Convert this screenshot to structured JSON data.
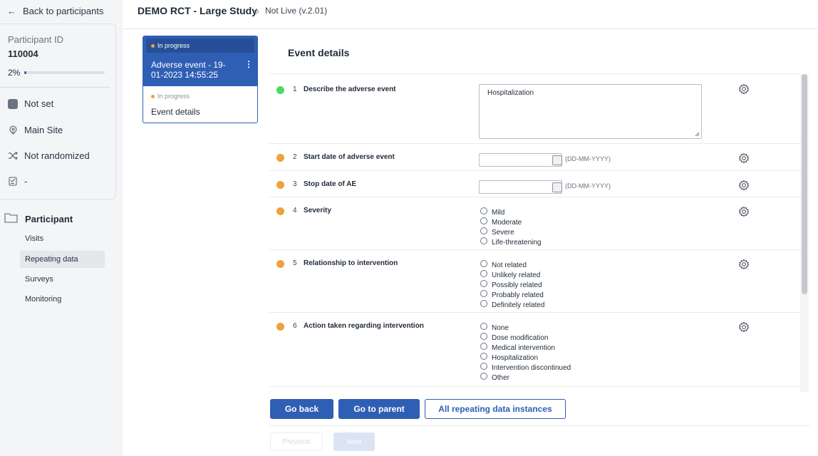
{
  "sidebar": {
    "back_label": "Back to participants",
    "participant_id_label": "Participant ID",
    "participant_id": "110004",
    "progress_text": "2%",
    "progress_fraction": 0.02,
    "status": "Not set",
    "site": "Main Site",
    "randomization": "Not randomized",
    "extra": "-",
    "section_label": "Participant",
    "nav_items": [
      "Visits",
      "Repeating data",
      "Surveys",
      "Monitoring"
    ],
    "active_nav": "Repeating data"
  },
  "header": {
    "study_name": "DEMO RCT - Large Study",
    "study_status": "Not Live (v.2.01)"
  },
  "event_card": {
    "status": "In progress",
    "title": "Adverse event - 19-01-2023 14:55:25",
    "sub_status": "In progress",
    "sub_name": "Event details"
  },
  "form": {
    "heading": "Event details",
    "questions": [
      {
        "num": "1",
        "label": "Describe the adverse event",
        "status_color": "#4cd964",
        "value": "Hospitalization"
      },
      {
        "num": "2",
        "label": "Start date of adverse event",
        "status_color": "#f0a03c",
        "hint": "(DD-MM-YYYY)"
      },
      {
        "num": "3",
        "label": "Stop date of AE",
        "status_color": "#f0a03c",
        "hint": "(DD-MM-YYYY)"
      },
      {
        "num": "4",
        "label": "Severity",
        "status_color": "#f0a03c",
        "options": [
          "Mild",
          "Moderate",
          "Severe",
          "Life-threatening"
        ]
      },
      {
        "num": "5",
        "label": "Relationship to intervention",
        "status_color": "#f0a03c",
        "options": [
          "Not related",
          "Unlikely related",
          "Possibly related",
          "Probably related",
          "Definitely related"
        ]
      },
      {
        "num": "6",
        "label": "Action taken regarding intervention",
        "status_color": "#f0a03c",
        "options": [
          "None",
          "Dose modification",
          "Medical intervention",
          "Hospitalization",
          "Intervention discontinued",
          "Other"
        ]
      }
    ]
  },
  "buttons": {
    "go_back": "Go back",
    "go_to_parent": "Go to parent",
    "all_instances": "All repeating data instances",
    "previous": "Previous",
    "next": "Next"
  },
  "colors": {
    "accent": "#2f5fb4",
    "in_progress": "#f0a03c",
    "complete": "#4cd964"
  }
}
